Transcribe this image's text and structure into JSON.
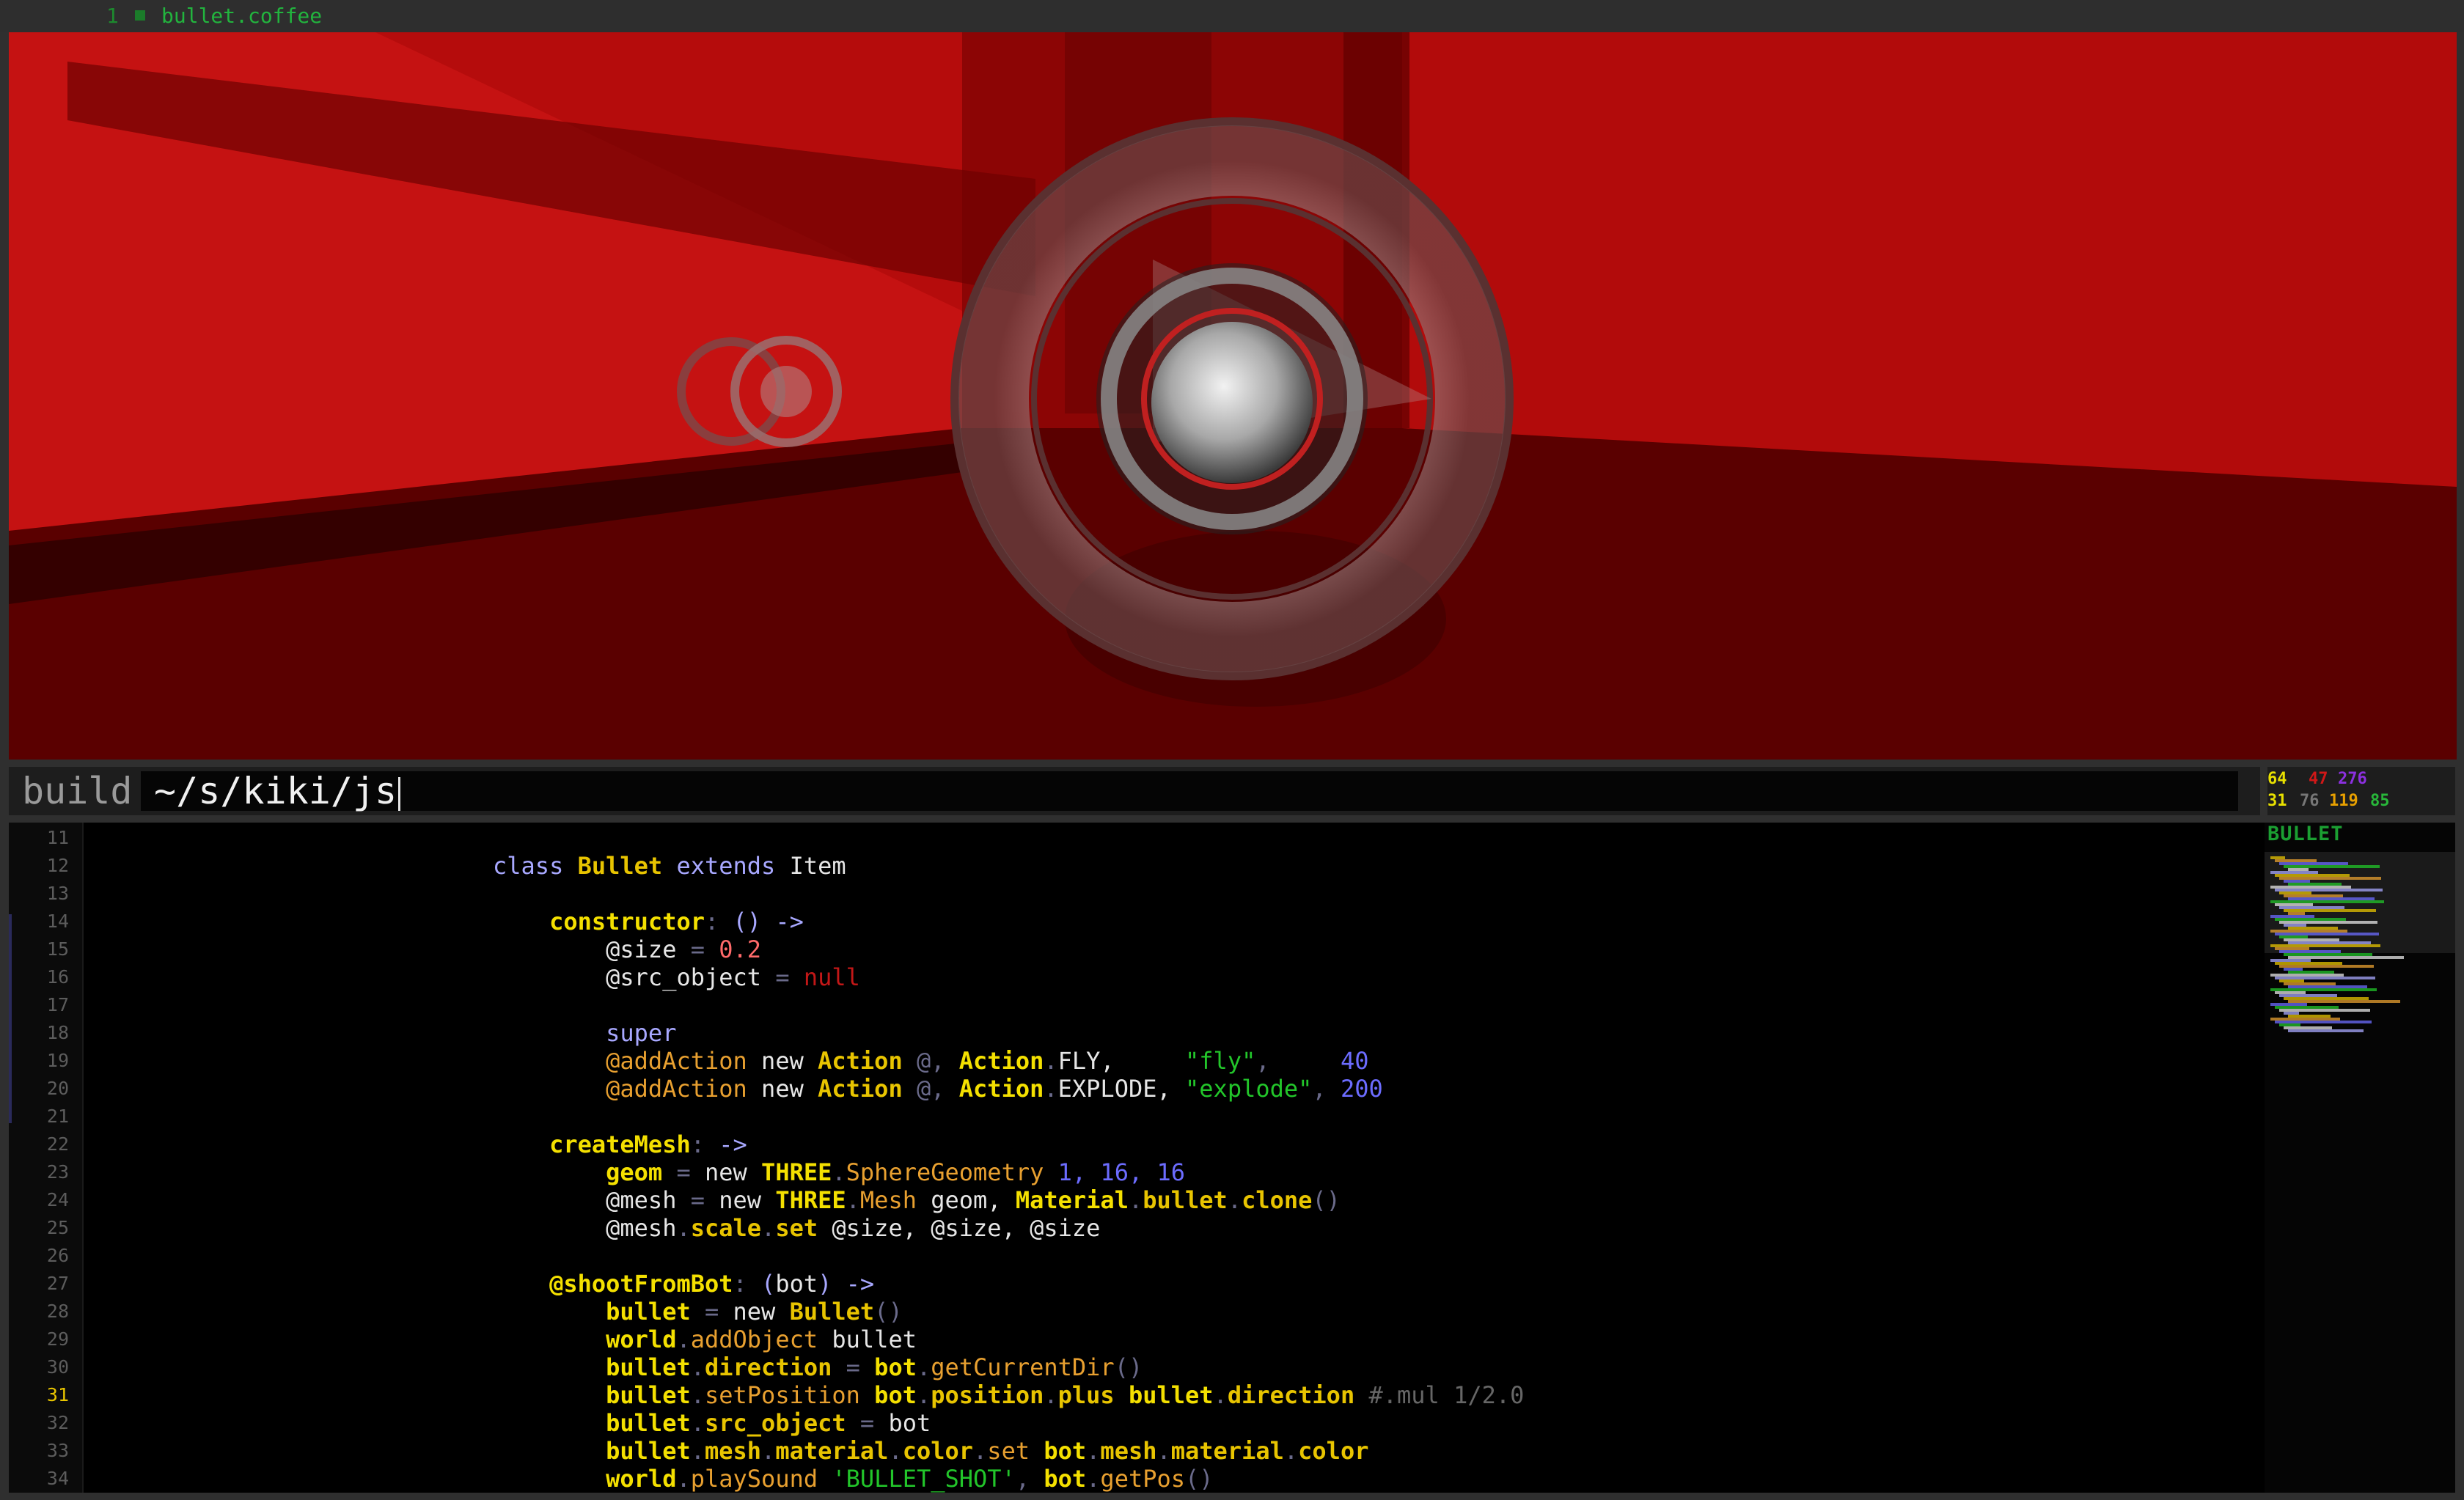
{
  "titlebar": {
    "tab_number": "1",
    "tab_name": "bullet.coffee"
  },
  "colors": {
    "accent_green": "#22b43e",
    "keyword": "#a8a8ff",
    "class_name": "#e8c400",
    "function": "#f0d000",
    "number": "#6c6cff",
    "string_green": "#22c52a",
    "null_red": "#c21717",
    "punct": "#5a5a7a",
    "property": "#e8e8e8",
    "at_var": "#e07a30"
  },
  "command": {
    "label": "build",
    "input": "~/s/kiki/js"
  },
  "stats": {
    "a1": "64",
    "a2": "47",
    "a3": "276",
    "b1": "31",
    "b2": "76",
    "b3": "119",
    "b4": "85"
  },
  "minimap": {
    "title": "BULLET"
  },
  "editor": {
    "active_line": "31",
    "lines": [
      {
        "n": "11",
        "tokens": []
      },
      {
        "n": "12",
        "tokens": [
          {
            "t": "class ",
            "c": "kw"
          },
          {
            "t": "Bullet ",
            "c": "cls"
          },
          {
            "t": "extends ",
            "c": "kw"
          },
          {
            "t": "Item",
            "c": "plain"
          }
        ]
      },
      {
        "n": "13",
        "tokens": []
      },
      {
        "n": "14",
        "tokens": [
          {
            "t": "    constructor",
            "c": "fn"
          },
          {
            "t": ": ",
            "c": "punct"
          },
          {
            "t": "() ",
            "c": "kw"
          },
          {
            "t": "->",
            "c": "kw"
          }
        ]
      },
      {
        "n": "15",
        "tokens": [
          {
            "t": "        @size",
            "c": "plain"
          },
          {
            "t": " = ",
            "c": "punct"
          },
          {
            "t": "0.2",
            "c": "numr"
          }
        ]
      },
      {
        "n": "16",
        "tokens": [
          {
            "t": "        @src_object",
            "c": "plain"
          },
          {
            "t": " = ",
            "c": "punct"
          },
          {
            "t": "null",
            "c": "nul"
          }
        ]
      },
      {
        "n": "17",
        "tokens": []
      },
      {
        "n": "18",
        "tokens": [
          {
            "t": "        super",
            "c": "kw"
          }
        ]
      },
      {
        "n": "19",
        "tokens": [
          {
            "t": "        @addAction ",
            "c": "at"
          },
          {
            "t": "new ",
            "c": "plain"
          },
          {
            "t": "Action ",
            "c": "cls"
          },
          {
            "t": "@, ",
            "c": "punct"
          },
          {
            "t": "Action",
            "c": "fn"
          },
          {
            "t": ".",
            "c": "punct"
          },
          {
            "t": "FLY,     ",
            "c": "plain"
          },
          {
            "t": "\"fly\"",
            "c": "str"
          },
          {
            "t": ",     ",
            "c": "punct"
          },
          {
            "t": "40",
            "c": "num"
          }
        ]
      },
      {
        "n": "20",
        "tokens": [
          {
            "t": "        @addAction ",
            "c": "at"
          },
          {
            "t": "new ",
            "c": "plain"
          },
          {
            "t": "Action ",
            "c": "cls"
          },
          {
            "t": "@, ",
            "c": "punct"
          },
          {
            "t": "Action",
            "c": "fn"
          },
          {
            "t": ".",
            "c": "punct"
          },
          {
            "t": "EXPLODE, ",
            "c": "plain"
          },
          {
            "t": "\"explode\"",
            "c": "str"
          },
          {
            "t": ", ",
            "c": "punct"
          },
          {
            "t": "200",
            "c": "num"
          }
        ]
      },
      {
        "n": "21",
        "tokens": []
      },
      {
        "n": "22",
        "tokens": [
          {
            "t": "    createMesh",
            "c": "fn"
          },
          {
            "t": ": ",
            "c": "punct"
          },
          {
            "t": "->",
            "c": "kw"
          }
        ]
      },
      {
        "n": "23",
        "tokens": [
          {
            "t": "        geom",
            "c": "fn"
          },
          {
            "t": " = ",
            "c": "punct"
          },
          {
            "t": "new ",
            "c": "plain"
          },
          {
            "t": "THREE",
            "c": "fn"
          },
          {
            "t": ".",
            "c": "punct"
          },
          {
            "t": "SphereGeometry ",
            "c": "at"
          },
          {
            "t": "1, 16, 16",
            "c": "num"
          }
        ]
      },
      {
        "n": "24",
        "tokens": [
          {
            "t": "        @mesh",
            "c": "plain"
          },
          {
            "t": " = ",
            "c": "punct"
          },
          {
            "t": "new ",
            "c": "plain"
          },
          {
            "t": "THREE",
            "c": "fn"
          },
          {
            "t": ".",
            "c": "punct"
          },
          {
            "t": "Mesh ",
            "c": "at"
          },
          {
            "t": "geom, ",
            "c": "plain"
          },
          {
            "t": "Material",
            "c": "fn"
          },
          {
            "t": ".",
            "c": "punct"
          },
          {
            "t": "bullet",
            "c": "cls"
          },
          {
            "t": ".",
            "c": "punct"
          },
          {
            "t": "clone",
            "c": "cls"
          },
          {
            "t": "()",
            "c": "punct"
          }
        ]
      },
      {
        "n": "25",
        "tokens": [
          {
            "t": "        @mesh",
            "c": "plain"
          },
          {
            "t": ".",
            "c": "punct"
          },
          {
            "t": "scale",
            "c": "cls"
          },
          {
            "t": ".",
            "c": "punct"
          },
          {
            "t": "set ",
            "c": "cls"
          },
          {
            "t": "@size, @size, @size",
            "c": "plain"
          }
        ]
      },
      {
        "n": "26",
        "tokens": []
      },
      {
        "n": "27",
        "tokens": [
          {
            "t": "    @shootFromBot",
            "c": "fn"
          },
          {
            "t": ": ",
            "c": "punct"
          },
          {
            "t": "(",
            "c": "kw"
          },
          {
            "t": "bot",
            "c": "plain"
          },
          {
            "t": ") ",
            "c": "kw"
          },
          {
            "t": "->",
            "c": "kw"
          }
        ]
      },
      {
        "n": "28",
        "tokens": [
          {
            "t": "        bullet",
            "c": "fn"
          },
          {
            "t": " = ",
            "c": "punct"
          },
          {
            "t": "new ",
            "c": "plain"
          },
          {
            "t": "Bullet",
            "c": "cls"
          },
          {
            "t": "()",
            "c": "punct"
          }
        ]
      },
      {
        "n": "29",
        "tokens": [
          {
            "t": "        world",
            "c": "fn"
          },
          {
            "t": ".",
            "c": "punct"
          },
          {
            "t": "addObject ",
            "c": "at"
          },
          {
            "t": "bullet",
            "c": "plain"
          }
        ]
      },
      {
        "n": "30",
        "tokens": [
          {
            "t": "        bullet",
            "c": "fn"
          },
          {
            "t": ".",
            "c": "punct"
          },
          {
            "t": "direction",
            "c": "cls"
          },
          {
            "t": " = ",
            "c": "punct"
          },
          {
            "t": "bot",
            "c": "fn"
          },
          {
            "t": ".",
            "c": "punct"
          },
          {
            "t": "getCurrentDir",
            "c": "at"
          },
          {
            "t": "()",
            "c": "punct"
          }
        ]
      },
      {
        "n": "31",
        "tokens": [
          {
            "t": "        bullet",
            "c": "fn"
          },
          {
            "t": ".",
            "c": "punct"
          },
          {
            "t": "setPosition ",
            "c": "at"
          },
          {
            "t": "bot",
            "c": "fn"
          },
          {
            "t": ".",
            "c": "punct"
          },
          {
            "t": "position",
            "c": "cls"
          },
          {
            "t": ".",
            "c": "punct"
          },
          {
            "t": "plus ",
            "c": "cls"
          },
          {
            "t": "bullet",
            "c": "fn"
          },
          {
            "t": ".",
            "c": "punct"
          },
          {
            "t": "direction ",
            "c": "cls"
          },
          {
            "t": "#.mul 1/2.0",
            "c": "cmt"
          }
        ]
      },
      {
        "n": "32",
        "tokens": [
          {
            "t": "        bullet",
            "c": "fn"
          },
          {
            "t": ".",
            "c": "punct"
          },
          {
            "t": "src_object",
            "c": "cls"
          },
          {
            "t": " = ",
            "c": "punct"
          },
          {
            "t": "bot",
            "c": "plain"
          }
        ]
      },
      {
        "n": "33",
        "tokens": [
          {
            "t": "        bullet",
            "c": "fn"
          },
          {
            "t": ".",
            "c": "punct"
          },
          {
            "t": "mesh",
            "c": "cls"
          },
          {
            "t": ".",
            "c": "punct"
          },
          {
            "t": "material",
            "c": "cls"
          },
          {
            "t": ".",
            "c": "punct"
          },
          {
            "t": "color",
            "c": "cls"
          },
          {
            "t": ".",
            "c": "punct"
          },
          {
            "t": "set ",
            "c": "at"
          },
          {
            "t": "bot",
            "c": "fn"
          },
          {
            "t": ".",
            "c": "punct"
          },
          {
            "t": "mesh",
            "c": "cls"
          },
          {
            "t": ".",
            "c": "punct"
          },
          {
            "t": "material",
            "c": "cls"
          },
          {
            "t": ".",
            "c": "punct"
          },
          {
            "t": "color",
            "c": "cls"
          }
        ]
      },
      {
        "n": "34",
        "tokens": [
          {
            "t": "        world",
            "c": "fn"
          },
          {
            "t": ".",
            "c": "punct"
          },
          {
            "t": "playSound ",
            "c": "at"
          },
          {
            "t": "'BULLET_SHOT'",
            "c": "str"
          },
          {
            "t": ", ",
            "c": "punct"
          },
          {
            "t": "bot",
            "c": "fn"
          },
          {
            "t": ".",
            "c": "punct"
          },
          {
            "t": "getPos",
            "c": "at"
          },
          {
            "t": "()",
            "c": "punct"
          }
        ]
      }
    ]
  }
}
